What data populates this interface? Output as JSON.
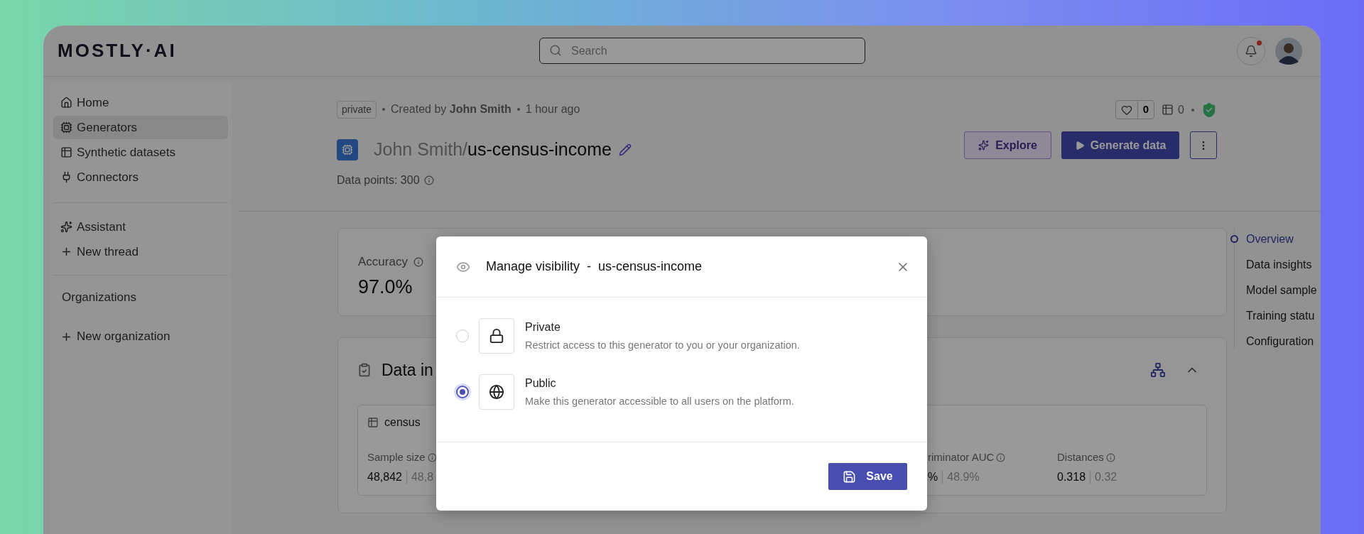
{
  "header": {
    "logo": "MOSTLY·AI",
    "search_placeholder": "Search",
    "notification_unread": true
  },
  "sidebar": {
    "nav": [
      {
        "label": "Home",
        "selected": false,
        "kind": "home"
      },
      {
        "label": "Generators",
        "selected": true,
        "kind": "generator"
      },
      {
        "label": "Synthetic datasets",
        "selected": false,
        "kind": "dataset"
      },
      {
        "label": "Connectors",
        "selected": false,
        "kind": "connector"
      }
    ],
    "assistant": [
      {
        "label": "Assistant",
        "kind": "sparkle"
      },
      {
        "label": "New thread",
        "kind": "plus"
      }
    ],
    "organizations_title": "Organizations",
    "new_organization": "New organization"
  },
  "generator": {
    "visibility": "private",
    "created_by": "Created by **John Smith**",
    "time": "1 hour ago",
    "owner": "John Smith/",
    "name": "us-census-income",
    "data_points": "Data points: 300",
    "likes": "0",
    "datasets": "0",
    "verified": true,
    "buttons": [
      "Explore",
      "Generate data"
    ]
  },
  "accuracy": {
    "label": "Accuracy",
    "value": "97.0%"
  },
  "insights": {
    "title": "Data in",
    "table": "census",
    "expanded": true,
    "metrics": [
      {
        "label": "Sample size",
        "value": "48,842",
        "reference": "48,8"
      },
      {
        "label": "riminator AUC",
        "value": "%",
        "reference": "48.9%"
      },
      {
        "label": "Distances",
        "value": "0.318",
        "reference": "0.32"
      }
    ]
  },
  "page_nav": [
    {
      "label": "Overview",
      "selected": true
    },
    {
      "label": "Data insights",
      "selected": false
    },
    {
      "label": "Model sample",
      "selected": false
    },
    {
      "label": "Training statu",
      "selected": false
    },
    {
      "label": "Configuration",
      "selected": false
    }
  ],
  "modal": {
    "title": "Manage visibility",
    "separator": "-",
    "name": "us-census-income",
    "options": [
      {
        "kind": "lock",
        "title": "Private",
        "description": "Restrict access to this generator to you or your organization.",
        "selected": false
      },
      {
        "kind": "globe",
        "title": "Public",
        "description": "Make this generator accessible to all users on the platform.",
        "selected": true
      }
    ],
    "save": "Save"
  }
}
